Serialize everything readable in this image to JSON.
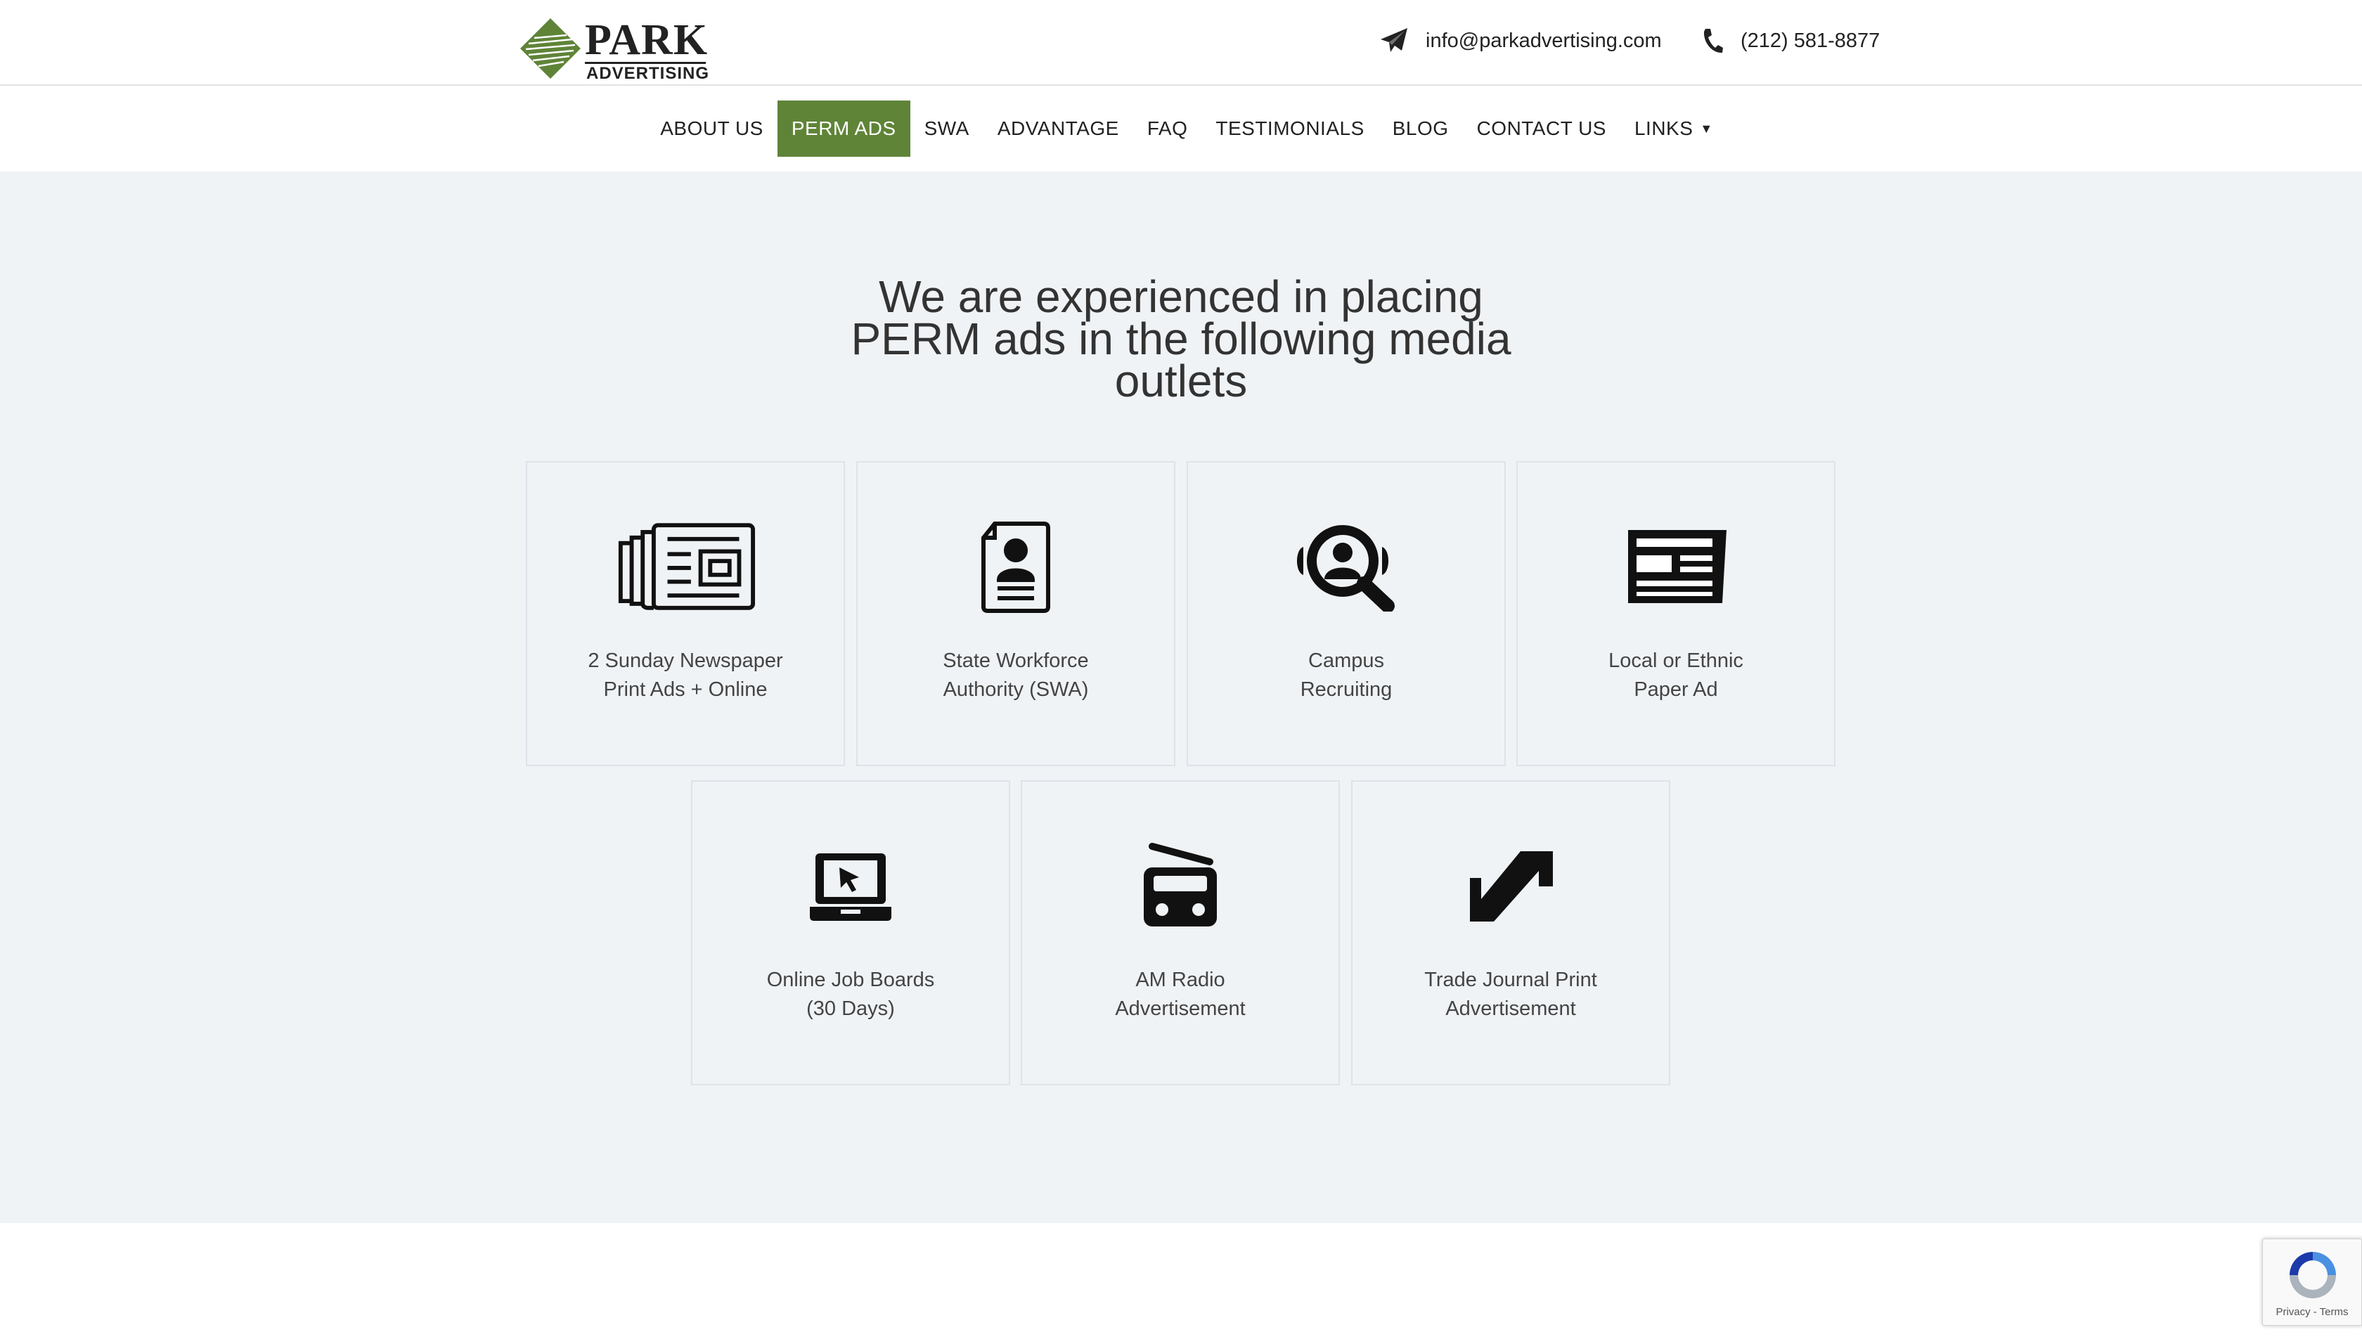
{
  "header": {
    "logo": {
      "top": "PARK",
      "bottom": "ADVERTISING",
      "icon": "diamond-logo-icon",
      "color": "#5f8438"
    },
    "email": {
      "icon": "paper-plane-icon",
      "text": "info@parkadvertising.com"
    },
    "phone": {
      "icon": "phone-icon",
      "text": "(212) 581-8877"
    }
  },
  "nav": {
    "active_color": "#5f8438",
    "items": [
      {
        "label": "ABOUT US"
      },
      {
        "label": "PERM ADS",
        "active": true
      },
      {
        "label": "SWA"
      },
      {
        "label": "ADVANTAGE"
      },
      {
        "label": "FAQ"
      },
      {
        "label": "TESTIMONIALS"
      },
      {
        "label": "BLOG"
      },
      {
        "label": "CONTACT US"
      },
      {
        "label": "LINKS",
        "dropdown": true
      }
    ]
  },
  "main": {
    "heading_lines": [
      "We are experienced in placing",
      "PERM ads in the following media",
      "outlets"
    ],
    "cards": [
      {
        "icon": "newspaper-icon",
        "lines": [
          "2 Sunday Newspaper",
          "Print Ads + Online"
        ]
      },
      {
        "icon": "id-document-icon",
        "lines": [
          "State Workforce",
          "Authority (SWA)"
        ]
      },
      {
        "icon": "search-person-icon",
        "lines": [
          "Campus",
          "Recruiting"
        ]
      },
      {
        "icon": "news-page-icon",
        "lines": [
          "Local or Ethnic",
          "Paper Ad"
        ]
      },
      {
        "icon": "laptop-cursor-icon",
        "lines": [
          "Online Job Boards",
          "(30 Days)"
        ]
      },
      {
        "icon": "radio-icon",
        "lines": [
          "AM Radio",
          "Advertisement"
        ]
      },
      {
        "icon": "journal-pen-icon",
        "lines": [
          "Trade Journal Print",
          "Advertisement"
        ]
      }
    ]
  },
  "recaptcha": {
    "text": "Privacy - Terms",
    "icon": "recaptcha-icon"
  }
}
